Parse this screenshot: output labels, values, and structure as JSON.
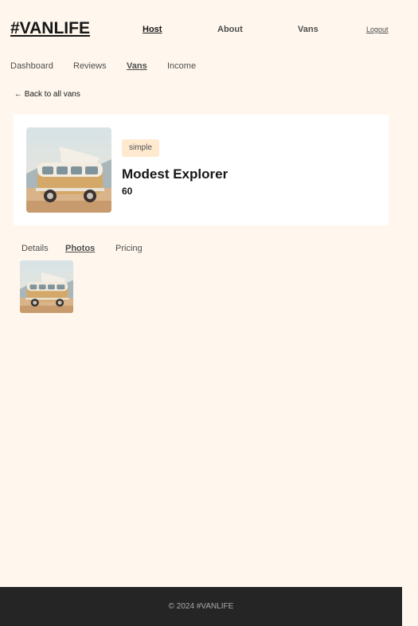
{
  "header": {
    "logo": "#VANLIFE",
    "nav": {
      "host": "Host",
      "about": "About",
      "vans": "Vans",
      "logout": "Logout"
    }
  },
  "subnav": {
    "dashboard": "Dashboard",
    "reviews": "Reviews",
    "vans": "Vans",
    "income": "Income"
  },
  "back_link": "← Back to all vans",
  "van": {
    "type": "simple",
    "name": "Modest Explorer",
    "price": "60",
    "image_icon": "van-photo"
  },
  "tabs": {
    "details": "Details",
    "photos": "Photos",
    "pricing": "Pricing"
  },
  "footer": {
    "copyright": "© 2024 #VANLIFE"
  },
  "colors": {
    "background": "#FFF7ED",
    "card": "#FFFFFF",
    "badge_bg": "#FFEAD0",
    "footer_bg": "#252525"
  }
}
